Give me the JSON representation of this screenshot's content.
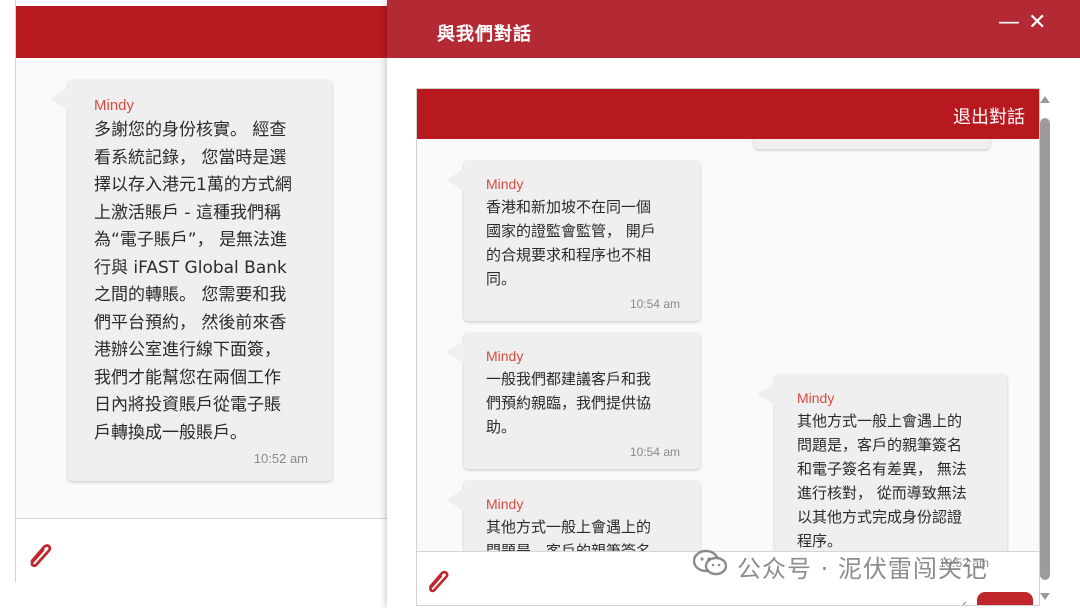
{
  "left_window": {
    "message": {
      "sender": "Mindy",
      "text": "多謝您的身份核實。 經查\n看系統記錄， 您當時是選\n擇以存入港元1萬的方式網\n上激活賬戶 - 這種我們稱\n為“電子賬戶”， 是無法進\n行與 iFAST Global Bank\n之間的轉賬。 您需要和我\n們平台預約， 然後前來香\n港辦公室進行線下面簽，\n我們才能幫您在兩個工作\n日內將投資賬戶從電子賬\n戶轉換成一般賬戶。",
      "time": "10:52 am"
    },
    "attach_icon": "paperclip-icon"
  },
  "right_window": {
    "title": "與我們對話",
    "minimize_label": "—",
    "close_label": "✕",
    "exit_label": "退出對話",
    "messages": [
      {
        "sender": "Mindy",
        "text": "香港和新加坡不在同一個\n國家的證監會監管， 開戶\n的合規要求和程序也不相\n同。",
        "time": "10:54 am"
      },
      {
        "sender": "Mindy",
        "text": "一般我們都建議客戶和我\n們預約親臨，我們提供協\n助。",
        "time": "10:54 am"
      },
      {
        "sender": "Mindy",
        "text": "其他方式一般上會遇上的\n問題是，客戶的親筆簽名"
      },
      {
        "sender": "Mindy",
        "text": "其他方式一般上會遇上的\n問題是，客戶的親筆簽名\n和電子簽名有差異， 無法\n進行核對， 從而導致無法\n以其他方式完成身份認證\n程序。"
      }
    ],
    "partial_time": "10:52 am",
    "attach_icon": "paperclip-icon",
    "accent_color": "#b8191f",
    "title_bar_color": "#b32a34"
  },
  "watermark": {
    "text": "公众号 · 泥伏雷闯关记",
    "icon": "wechat-logo"
  }
}
